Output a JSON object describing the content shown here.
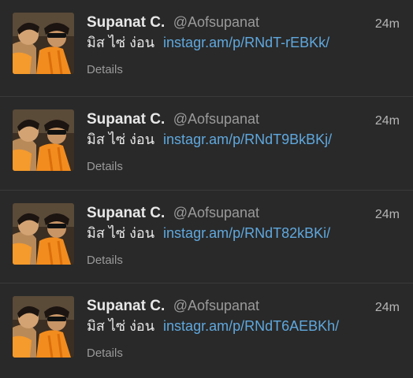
{
  "tweets": [
    {
      "fullname": "Supanat C.",
      "handle": "@Aofsupanat",
      "time": "24m",
      "text": "มิส ไซ่ ง่อน",
      "link": "instagr.am/p/RNdT-rEBKk/",
      "details": "Details",
      "avatar_icon": "profile-photo"
    },
    {
      "fullname": "Supanat C.",
      "handle": "@Aofsupanat",
      "time": "24m",
      "text": "มิส ไซ่ ง่อน",
      "link": "instagr.am/p/RNdT9BkBKj/",
      "details": "Details",
      "avatar_icon": "profile-photo"
    },
    {
      "fullname": "Supanat C.",
      "handle": "@Aofsupanat",
      "time": "24m",
      "text": "มิส ไซ่ ง่อน",
      "link": "instagr.am/p/RNdT82kBKi/",
      "details": "Details",
      "avatar_icon": "profile-photo"
    },
    {
      "fullname": "Supanat C.",
      "handle": "@Aofsupanat",
      "time": "24m",
      "text": "มิส ไซ่ ง่อน",
      "link": "instagr.am/p/RNdT6AEBKh/",
      "details": "Details",
      "avatar_icon": "profile-photo"
    }
  ],
  "colors": {
    "background": "#292929",
    "divider": "#3a3a3a",
    "name": "#e8e8e8",
    "handle": "#9a9a9a",
    "link": "#5fa8de"
  }
}
